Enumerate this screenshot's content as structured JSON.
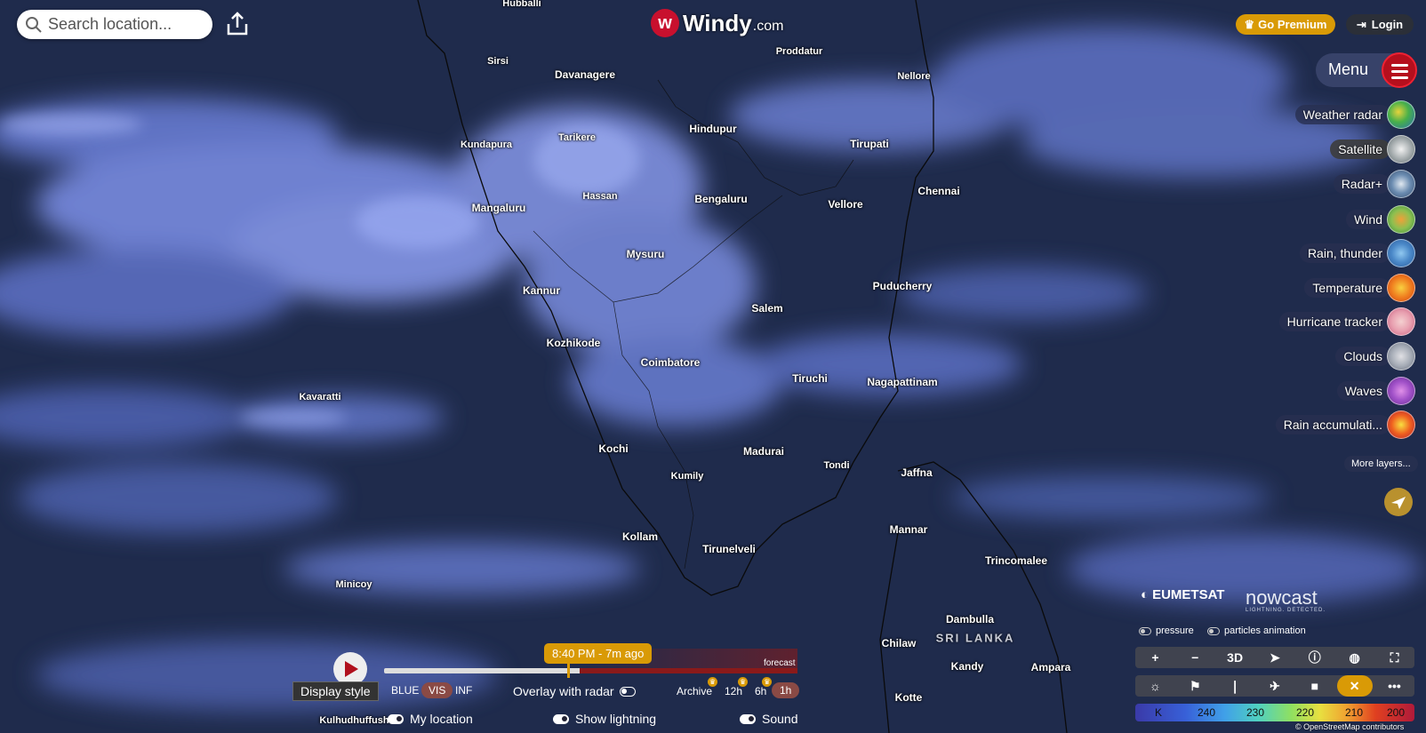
{
  "search": {
    "placeholder": "Search location..."
  },
  "logo": {
    "brand": "Windy",
    "domain": ".com"
  },
  "header": {
    "premium_label": "Go Premium",
    "login_label": "Login"
  },
  "menu": {
    "label": "Menu"
  },
  "layers": [
    {
      "label": "Weather radar",
      "active": false
    },
    {
      "label": "Satellite",
      "active": true
    },
    {
      "label": "Radar+",
      "active": false
    },
    {
      "label": "Wind",
      "active": false
    },
    {
      "label": "Rain, thunder",
      "active": false
    },
    {
      "label": "Temperature",
      "active": false
    },
    {
      "label": "Hurricane tracker",
      "active": false
    },
    {
      "label": "Clouds",
      "active": false
    },
    {
      "label": "Waves",
      "active": false
    },
    {
      "label": "Rain accumulati...",
      "active": false
    }
  ],
  "more_layers_label": "More layers...",
  "cities": {
    "hubballi": "Hubballi",
    "sirsi": "Sirsi",
    "davanagere": "Davanagere",
    "proddatur": "Proddatur",
    "nellore": "Nellore",
    "kundapura": "Kundapura",
    "tarikere": "Tarikere",
    "hindupur": "Hindupur",
    "tirupati": "Tirupati",
    "hassan": "Hassan",
    "bengaluru": "Bengaluru",
    "chennai": "Chennai",
    "mangaluru": "Mangaluru",
    "vellore": "Vellore",
    "mysuru": "Mysuru",
    "kannur": "Kannur",
    "puducherry": "Puducherry",
    "salem": "Salem",
    "kozhikode": "Kozhikode",
    "coimbatore": "Coimbatore",
    "tiruchi": "Tiruchi",
    "nagapattinam": "Nagapattinam",
    "kavaratti": "Kavaratti",
    "kochi": "Kochi",
    "madurai": "Madurai",
    "tondi": "Tondi",
    "jaffna": "Jaffna",
    "kumily": "Kumily",
    "kollam": "Kollam",
    "tirunelveli": "Tirunelveli",
    "mannar": "Mannar",
    "trincomalee": "Trincomalee",
    "minicoy": "Minicoy",
    "dambulla": "Dambulla",
    "chilaw": "Chilaw",
    "kandy": "Kandy",
    "ampara": "Ampara",
    "kotte": "Kotte",
    "kulhudhuffushi": "Kulhudhuffushi"
  },
  "country_label": "SRI LANKA",
  "credits": {
    "eumetsat": "EUMETSAT",
    "nowcast": "nowcast",
    "nowcast_tag": "LIGHTNING. DETECTED.",
    "osm": "© OpenStreetMap contributors"
  },
  "map_toggles": {
    "pressure": "pressure",
    "particles": "particles animation"
  },
  "toolbar": {
    "zoom_in": "+",
    "zoom_out": "−",
    "three_d": "3D",
    "more": "•••"
  },
  "legend": {
    "unit": "K",
    "ticks": [
      "240",
      "230",
      "220",
      "210",
      "200"
    ]
  },
  "timeline": {
    "time_label": "8:40 PM - 7m ago",
    "forecast_label": "forecast",
    "progress_fraction": 0.44
  },
  "bottom": {
    "display_style": "Display style",
    "modes": [
      "BLUE",
      "VIS",
      "INF"
    ],
    "selected_mode": "VIS",
    "overlay_radar": "Overlay with radar",
    "archive": "Archive",
    "intervals": [
      "12h",
      "6h",
      "1h"
    ],
    "selected_interval": "1h",
    "my_location": "My location",
    "show_lightning": "Show lightning",
    "sound": "Sound"
  },
  "colors": {
    "accent": "#d99a06",
    "brand_red": "#c8102e",
    "selected_chip": "#8a4a45"
  }
}
